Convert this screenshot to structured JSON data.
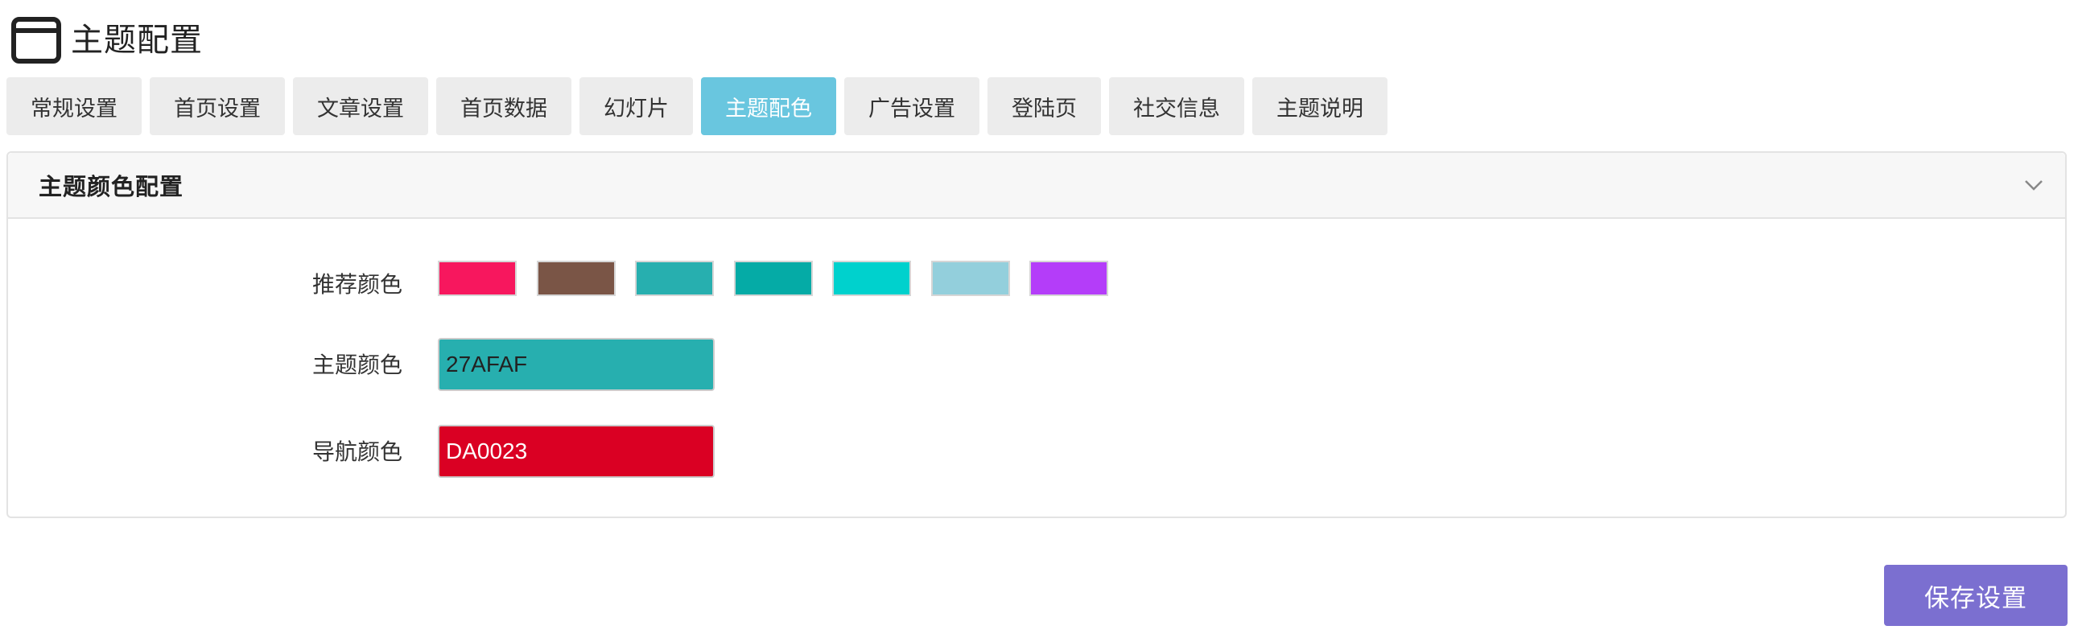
{
  "header": {
    "title": "主题配置",
    "icon": "browser-window-icon"
  },
  "tabs": [
    {
      "label": "常规设置",
      "active": false
    },
    {
      "label": "首页设置",
      "active": false
    },
    {
      "label": "文章设置",
      "active": false
    },
    {
      "label": "首页数据",
      "active": false
    },
    {
      "label": "幻灯片",
      "active": false
    },
    {
      "label": "主题配色",
      "active": true
    },
    {
      "label": "广告设置",
      "active": false
    },
    {
      "label": "登陆页",
      "active": false
    },
    {
      "label": "社交信息",
      "active": false
    },
    {
      "label": "主题说明",
      "active": false
    }
  ],
  "panel": {
    "title": "主题颜色配置",
    "collapse_icon": "chevron-down-icon",
    "recommended_label": "推荐颜色",
    "recommended_colors": [
      "#F7175E",
      "#7A5546",
      "#27AFAF",
      "#05ABA6",
      "#00D1CD",
      "#93CFDC",
      "#B43DF9"
    ],
    "theme_color_label": "主题颜色",
    "theme_color_value": "27AFAF",
    "theme_color_hex": "#27AFAF",
    "nav_color_label": "导航颜色",
    "nav_color_value": "DA0023",
    "nav_color_hex": "#DA0023"
  },
  "footer": {
    "save_label": "保存设置"
  },
  "colors": {
    "tab_bg": "#ECECEC",
    "tab_active_bg": "#69C6DF",
    "save_button_bg": "#7B6FD0"
  }
}
